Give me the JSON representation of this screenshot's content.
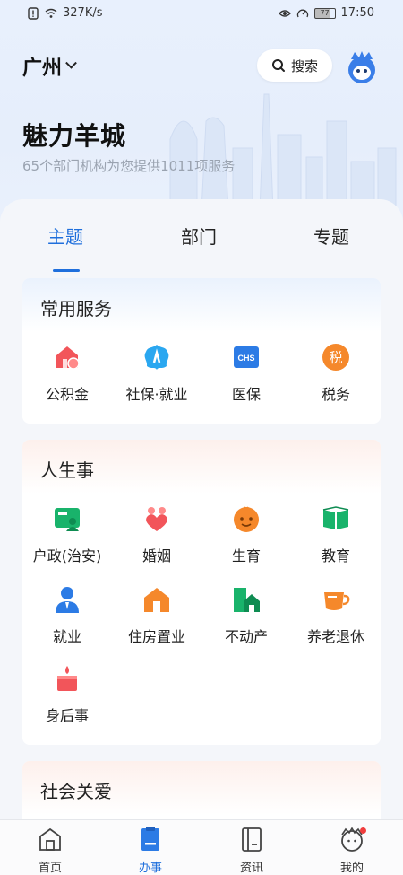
{
  "status_bar": {
    "net_speed": "327K/s",
    "battery": "77",
    "time": "17:50"
  },
  "header": {
    "city": "广州",
    "search_label": "搜索"
  },
  "hero": {
    "title": "魅力羊城",
    "subtitle": "65个部门机构为您提供1011项服务"
  },
  "tabs": [
    {
      "label": "主题",
      "active": true
    },
    {
      "label": "部门",
      "active": false
    },
    {
      "label": "专题",
      "active": false
    }
  ],
  "cards": [
    {
      "title": "常用服务",
      "items": [
        {
          "label": "公积金",
          "icon": "housing-fund-icon",
          "color": "#f2555a"
        },
        {
          "label": "社保·就业",
          "icon": "social-security-icon",
          "color": "#2aa7f0"
        },
        {
          "label": "医保",
          "icon": "chs-medical-icon",
          "color": "#2c7be5",
          "badge": "CHS"
        },
        {
          "label": "税务",
          "icon": "tax-icon",
          "color": "#f5882b",
          "badge": "税"
        }
      ]
    },
    {
      "title": "人生事",
      "items": [
        {
          "label": "户政(治安)",
          "icon": "household-id-icon",
          "color": "#19b36b"
        },
        {
          "label": "婚姻",
          "icon": "marriage-hearts-icon",
          "color": "#f2555a"
        },
        {
          "label": "生育",
          "icon": "baby-face-icon",
          "color": "#f5882b"
        },
        {
          "label": "教育",
          "icon": "book-icon",
          "color": "#19b36b"
        },
        {
          "label": "就业",
          "icon": "employee-icon",
          "color": "#2c7be5"
        },
        {
          "label": "住房置业",
          "icon": "house-icon",
          "color": "#f5882b"
        },
        {
          "label": "不动产",
          "icon": "property-icon",
          "color": "#19b36b"
        },
        {
          "label": "养老退休",
          "icon": "teacup-icon",
          "color": "#f5882b"
        },
        {
          "label": "身后事",
          "icon": "candle-icon",
          "color": "#f2555a"
        }
      ]
    },
    {
      "title": "社会关爱",
      "items": []
    }
  ],
  "bottom_nav": [
    {
      "label": "首页",
      "icon": "home-icon",
      "active": false
    },
    {
      "label": "办事",
      "icon": "tasks-icon",
      "active": true
    },
    {
      "label": "资讯",
      "icon": "news-icon",
      "active": false
    },
    {
      "label": "我的",
      "icon": "profile-icon",
      "active": false
    }
  ],
  "colors": {
    "accent": "#1f6fdc",
    "notification": "#f03d3d"
  }
}
